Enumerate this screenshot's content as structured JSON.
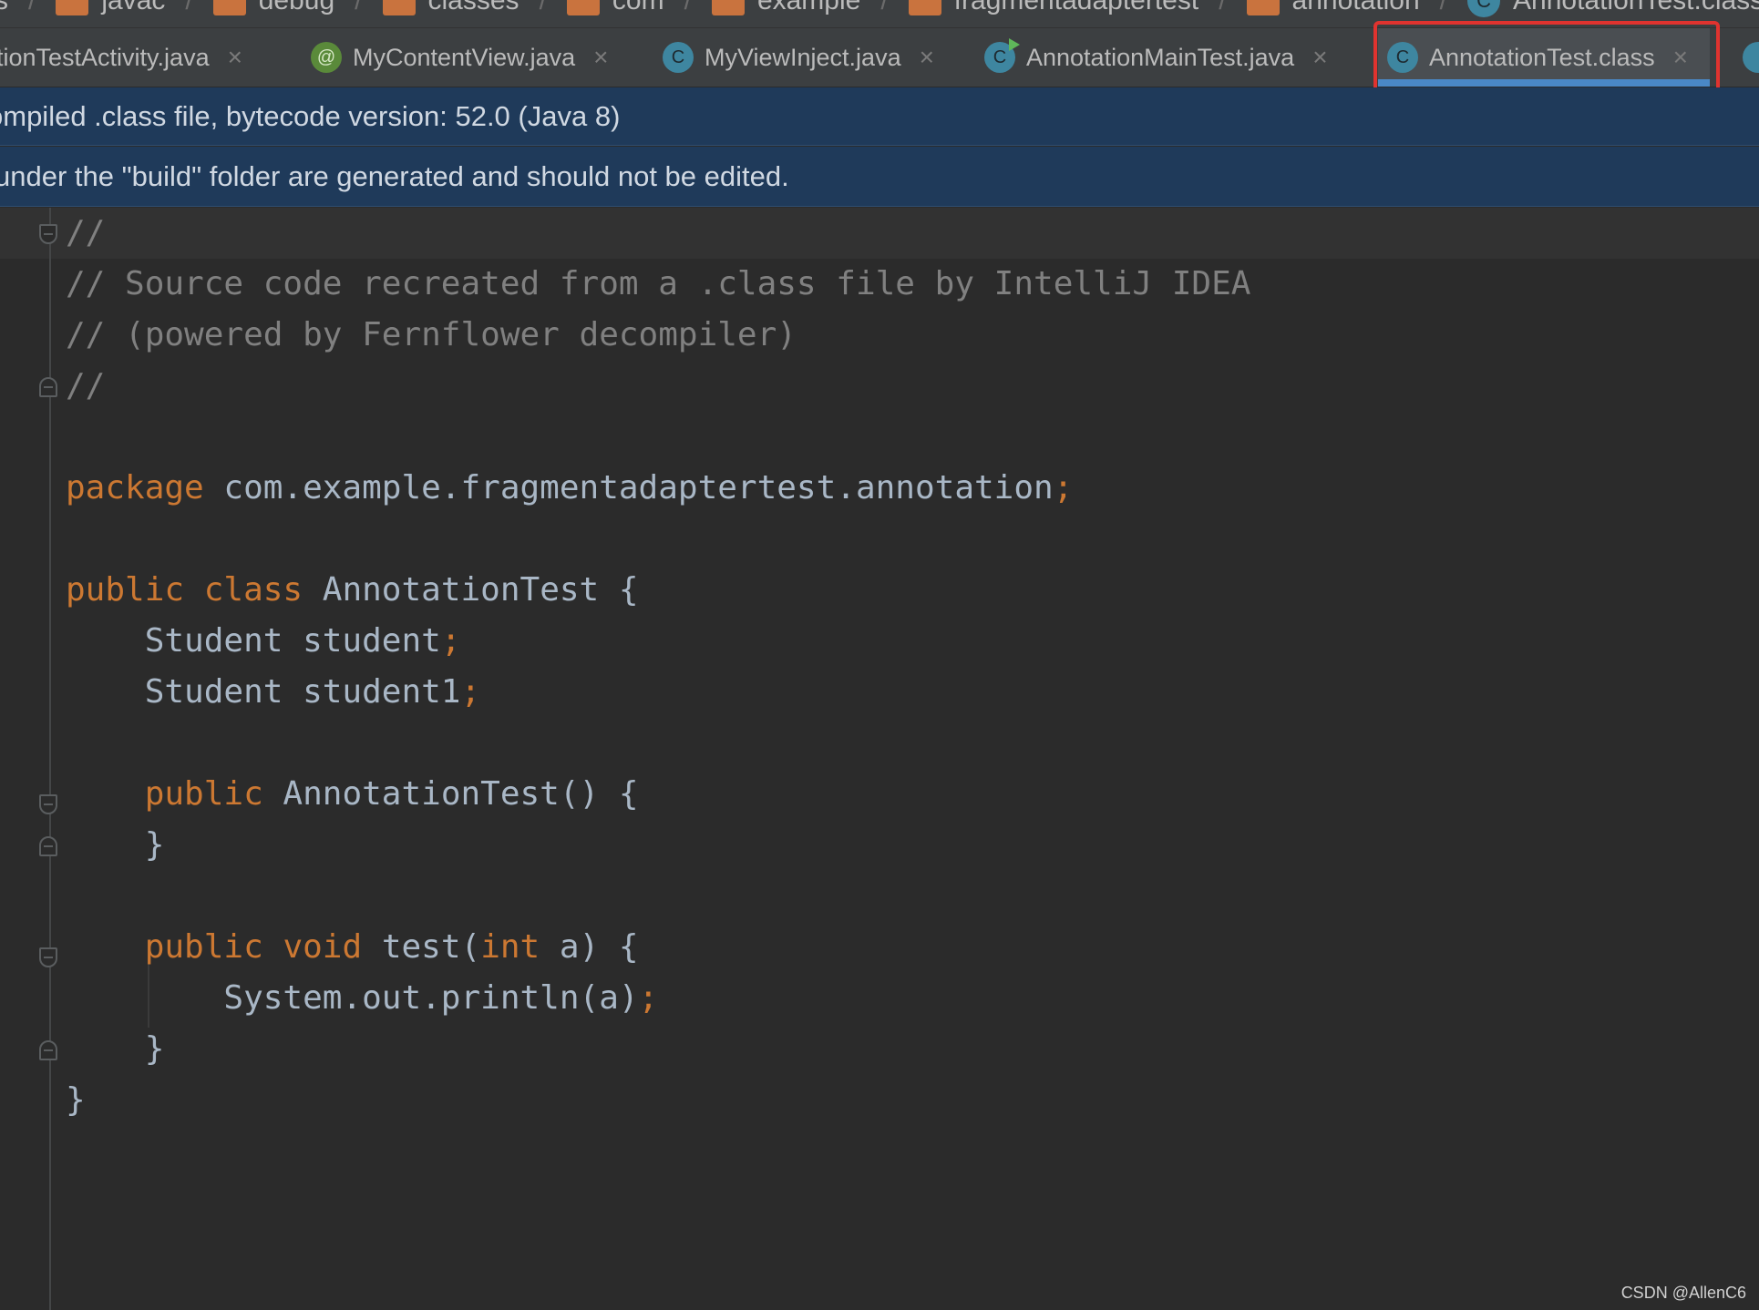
{
  "breadcrumb": {
    "items": [
      {
        "label": "s",
        "icon": "folder-icon"
      },
      {
        "label": "javac",
        "icon": "folder-icon"
      },
      {
        "label": "debug",
        "icon": "folder-icon"
      },
      {
        "label": "classes",
        "icon": "folder-icon"
      },
      {
        "label": "com",
        "icon": "folder-icon"
      },
      {
        "label": "example",
        "icon": "folder-icon"
      },
      {
        "label": "fragmentadaptertest",
        "icon": "folder-icon"
      },
      {
        "label": "annotation",
        "icon": "folder-icon"
      },
      {
        "label": "AnnotationTest.class",
        "icon": "class-icon"
      }
    ]
  },
  "tabs": [
    {
      "label": "tionTestActivity.java",
      "icon": "none",
      "close": "×"
    },
    {
      "label": "MyContentView.java",
      "icon": "annotation-icon",
      "glyph": "@",
      "close": "×"
    },
    {
      "label": "MyViewInject.java",
      "icon": "class-icon",
      "glyph": "C",
      "close": "×"
    },
    {
      "label": "AnnotationMainTest.java",
      "icon": "runnable-class-icon",
      "glyph": "C",
      "close": "×"
    },
    {
      "label": "AnnotationTest.class",
      "icon": "class-icon",
      "glyph": "C",
      "close": "×",
      "active": true
    }
  ],
  "banners": {
    "decompiled": "ompiled .class file, bytecode version: 52.0 (Java 8)",
    "build_warning": " under the \"build\" folder are generated and should not be edited."
  },
  "code": {
    "l1": "//",
    "l2": "// Source code recreated from a .class file by IntelliJ IDEA",
    "l3": "// (powered by Fernflower decompiler)",
    "l4": "//",
    "pkg_kw": "package",
    "pkg_name": " com.example.fragmentadaptertest.annotation",
    "semi": ";",
    "pub": "public",
    "cls": "class",
    "cls_name": " AnnotationTest {",
    "f1": "    Student student",
    "f2": "    Student student1",
    "ctor_name": " AnnotationTest() {",
    "close_inner": "    }",
    "void": "void",
    "test_name": " test(",
    "int": "int",
    "test_param": " a) {",
    "println": "        System.out.println(a)",
    "close_outer": "}"
  },
  "colors": {
    "keyword": "#cc7832",
    "comment": "#808080",
    "plain": "#a9b7c6",
    "banner_bg": "#1f3a5a",
    "highlight": "#e0332f",
    "active_tab_underline": "#4a88c7"
  },
  "watermark": "CSDN @AllenC6"
}
